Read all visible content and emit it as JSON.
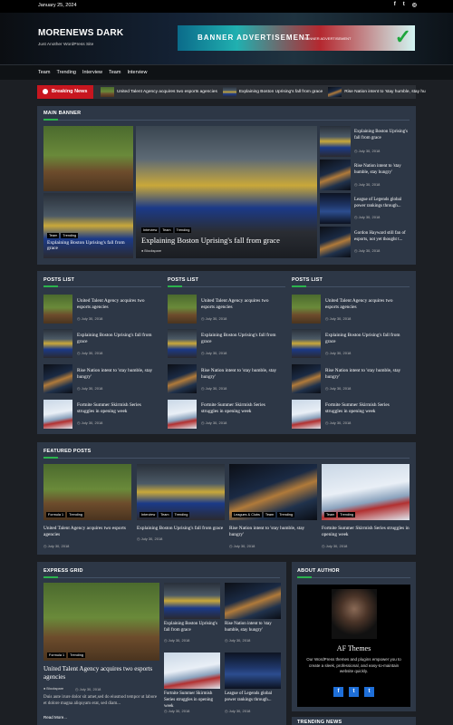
{
  "topbar": {
    "date": "January 25, 2024",
    "social": [
      "f",
      "t",
      "◎"
    ]
  },
  "header": {
    "brand": "MORENEWS DARK",
    "tagline": "Just Another WordPress Site",
    "ad": {
      "title": "BANNER ADVERTISEMENT",
      "subtitle": "BANNER ADVERTISEMENT"
    }
  },
  "nav": {
    "items": [
      "Team",
      "Trending",
      "Interview",
      "Team",
      "Interview"
    ]
  },
  "breaking": {
    "label": "Breaking News",
    "items": [
      "United Talent Agency acquires two esports agencies",
      "Explaining Boston Uprising's fall from grace",
      "Rise Nation intent to 'stay humble, stay hu"
    ]
  },
  "main_banner": {
    "title": "MAIN BANNER",
    "left_top_img": "horse",
    "left_bottom": {
      "title": "Explaining Boston Uprising's fall from grace",
      "tags": [
        "Team",
        "Trending"
      ]
    },
    "center": {
      "title": "Explaining Boston Uprising's fall from grace",
      "tags": [
        "Interview",
        "Team",
        "Trending"
      ],
      "author": "Blockspare"
    },
    "side": [
      {
        "title": "Explaining Boston Uprising's fall from grace",
        "date": "July 30, 2018"
      },
      {
        "title": "Rise Nation intent to 'stay humble, stay hungry'",
        "date": "July 30, 2018"
      },
      {
        "title": "League of Legends global power rankings through...",
        "date": "July 30, 2018"
      },
      {
        "title": "Gordon Hayward still fan of esports, not yet thought t...",
        "date": "July 30, 2018"
      }
    ]
  },
  "posts_list": {
    "title": "POSTS LIST",
    "items": [
      {
        "title": "United Talent Agency acquires two esports agencies",
        "date": "July 30, 2018"
      },
      {
        "title": "Explaining Boston Uprising's fall from grace",
        "date": "July 30, 2018"
      },
      {
        "title": "Rise Nation intent to 'stay humble, stay hungry'",
        "date": "July 30, 2018"
      },
      {
        "title": "Fortnite Summer Skirmish Series struggles in opening week",
        "date": "July 30, 2018"
      }
    ]
  },
  "featured": {
    "title": "FEATURED POSTS",
    "items": [
      {
        "title": "United Talent Agency acquires two esports agencies",
        "date": "July 30, 2018",
        "tags": [
          "Formula 1",
          "Trending"
        ]
      },
      {
        "title": "Explaining Boston Uprising's fall from grace",
        "date": "July 30, 2018",
        "tags": [
          "Interview",
          "Team",
          "Trending"
        ]
      },
      {
        "title": "Rise Nation intent to 'stay humble, stay hungry'",
        "date": "July 30, 2018",
        "tags": [
          "Leagues & Clubs",
          "Team",
          "Trending"
        ]
      },
      {
        "title": "Fortnite Summer Skirmish Series struggles in opening week",
        "date": "July 30, 2018",
        "tags": [
          "Team",
          "Trending"
        ]
      }
    ]
  },
  "express": {
    "title": "EXPRESS GRID",
    "main": {
      "title": "United Talent Agency acquires two esports agencies",
      "tags": [
        "Formula 1",
        "Trending"
      ],
      "author": "Blockspare",
      "date": "July 30, 2018",
      "excerpt": "Duis aute irure dolor sit amet,sed do eiusmod tempor ut labore et dolore magna aliquyam erat, sed diam...",
      "read_more": "Read More..."
    },
    "items": [
      {
        "title": "Explaining Boston Uprising's fall from grace",
        "date": "July 30, 2018"
      },
      {
        "title": "Rise Nation intent to 'stay humble, stay hungry'",
        "date": "July 30, 2018"
      },
      {
        "title": "Fortnite Summer Skirmish Series struggles in opening week",
        "date": "July 30, 2018"
      },
      {
        "title": "League of Legends global power rankings through...",
        "date": "July 30, 2018"
      }
    ]
  },
  "about": {
    "title": "ABOUT AUTHOR",
    "name": "AF Themes",
    "desc": "Our WordPress themes and plugins empower you to create a sleek, professional, and easy-to-maintain website quickly.",
    "social": [
      "f",
      "t",
      "t"
    ]
  },
  "trending": {
    "title": "TRENDING NEWS"
  }
}
